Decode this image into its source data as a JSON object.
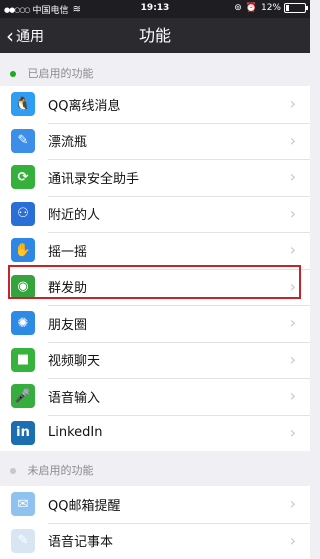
{
  "status_bar": {
    "signal_dots": "●●○○○",
    "carrier": "中国电信",
    "time": "19:13",
    "battery_percent": "12%"
  },
  "nav": {
    "back_label": "通用",
    "title": "功能"
  },
  "enabled_section": {
    "header": "已启用的功能",
    "dot_color": "#1aad19",
    "items": [
      {
        "label": "QQ离线消息",
        "icon": "qq-penguin-icon",
        "glyph": "🐧",
        "color": "#2e9ef2"
      },
      {
        "label": "漂流瓶",
        "icon": "drift-bottle-icon",
        "glyph": "✎",
        "color": "#3d8ee8"
      },
      {
        "label": "通讯录安全助手",
        "icon": "contacts-security-icon",
        "glyph": "⟳",
        "color": "#35b03b"
      },
      {
        "label": "附近的人",
        "icon": "people-nearby-icon",
        "glyph": "⚇",
        "color": "#2a6fd6"
      },
      {
        "label": "摇一摇",
        "icon": "shake-icon",
        "glyph": "✋",
        "color": "#2e86e6"
      },
      {
        "label": "群发助",
        "icon": "broadcast-icon",
        "glyph": "◉",
        "color": "#36a43c"
      },
      {
        "label": "朋友圈",
        "icon": "moments-icon",
        "glyph": "✺",
        "color": "#2d8be6"
      },
      {
        "label": "视频聊天",
        "icon": "video-chat-icon",
        "glyph": "■",
        "color": "#37b33d"
      },
      {
        "label": "语音输入",
        "icon": "voice-input-icon",
        "glyph": "🎤",
        "color": "#36ad3c"
      },
      {
        "label": "LinkedIn",
        "icon": "linkedin-icon",
        "glyph": "in",
        "color": "#1b6fb0"
      }
    ]
  },
  "disabled_section": {
    "header": "未启用的功能",
    "dot_color": "#c7c7cc",
    "items": [
      {
        "label": "QQ邮箱提醒",
        "icon": "qq-mail-icon",
        "glyph": "✉",
        "color": "#8fc2ee"
      },
      {
        "label": "语音记事本",
        "icon": "voice-notepad-icon",
        "glyph": "✎",
        "color": "#d8e6f4"
      }
    ]
  },
  "chevron_glyph": "›"
}
